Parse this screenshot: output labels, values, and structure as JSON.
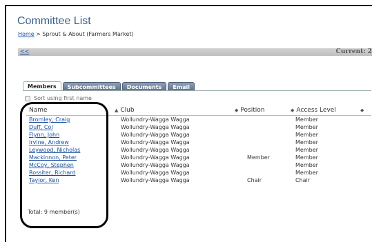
{
  "page": {
    "title": "Committee List",
    "breadcrumb_home": "Home",
    "breadcrumb_rest": " > Sprout & About (Farmers Market)"
  },
  "nav": {
    "prev": "<<",
    "current": "Current: 2"
  },
  "tabs": [
    "Members",
    "Subcommittees",
    "Documents",
    "Email"
  ],
  "sort_label": "Sort using first name",
  "table": {
    "columns": [
      "Name",
      "Club",
      "Position",
      "Access Level"
    ],
    "rows": [
      {
        "name": "Bromley, Craig",
        "club": "Wollundry-Wagga Wagga",
        "position": "",
        "access": "Member"
      },
      {
        "name": "Duff, Col",
        "club": "Wollundry-Wagga Wagga",
        "position": "",
        "access": "Member"
      },
      {
        "name": "Flynn, John",
        "club": "Wollundry-Wagga Wagga",
        "position": "",
        "access": "Member"
      },
      {
        "name": "Irvine, Andrew",
        "club": "Wollundry-Wagga Wagga",
        "position": "",
        "access": "Member"
      },
      {
        "name": "Leywood, Nicholas",
        "club": "Wollundry-Wagga Wagga",
        "position": "",
        "access": "Member"
      },
      {
        "name": "Mackinnon, Peter",
        "club": "Wollundry-Wagga Wagga",
        "position": "Member",
        "access": "Member"
      },
      {
        "name": "McCoy, Stephen",
        "club": "Wollundry-Wagga Wagga",
        "position": "",
        "access": "Member"
      },
      {
        "name": "Rossiter, Richard",
        "club": "Wollundry-Wagga Wagga",
        "position": "",
        "access": "Member"
      },
      {
        "name": "Taylor, Ken",
        "club": "Wollundry-Wagga Wagga",
        "position": "Chair",
        "access": "Chair"
      }
    ]
  },
  "total": "Total: 9 member(s)"
}
